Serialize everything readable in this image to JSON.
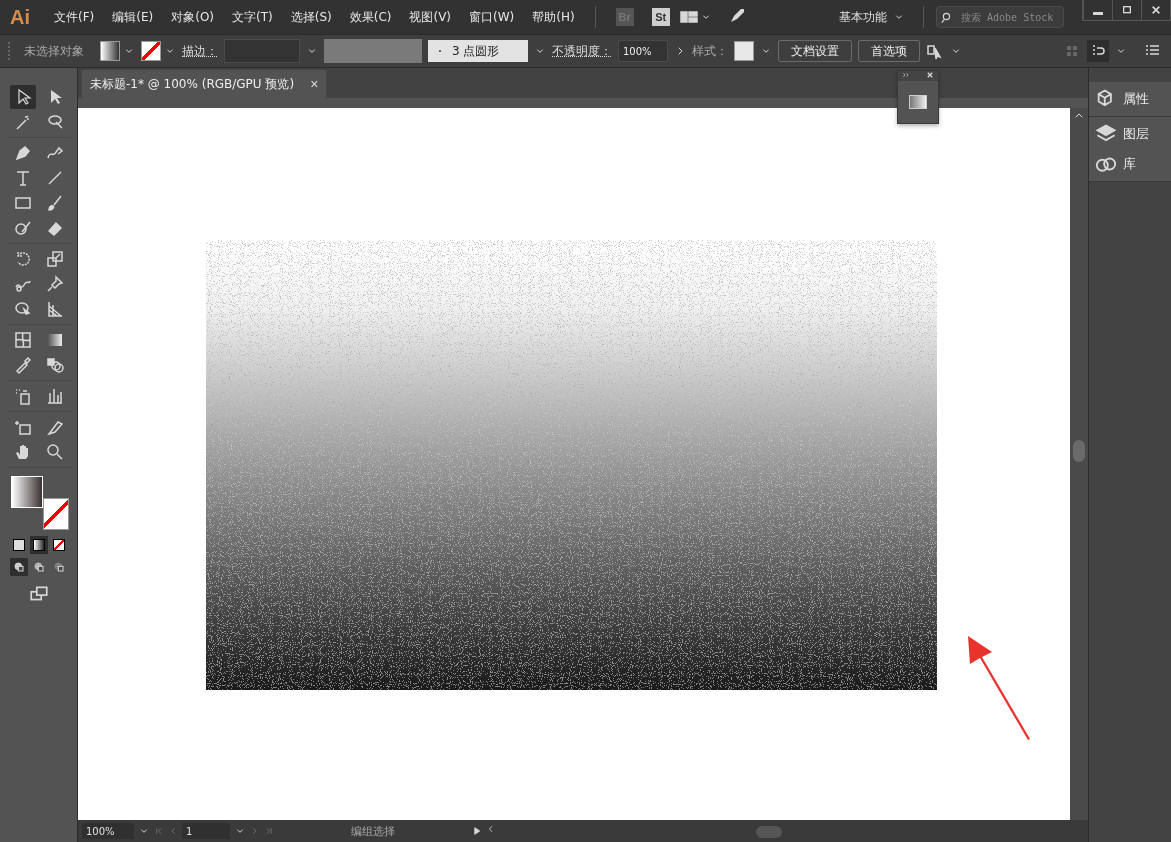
{
  "app_logo": "Ai",
  "menu": [
    "文件(F)",
    "编辑(E)",
    "对象(O)",
    "文字(T)",
    "选择(S)",
    "效果(C)",
    "视图(V)",
    "窗口(W)",
    "帮助(H)"
  ],
  "app_badges": [
    {
      "label": "Br",
      "disabled": true
    },
    {
      "label": "St",
      "disabled": false
    }
  ],
  "workspace": "基本功能",
  "search": {
    "placeholder": "搜索 Adobe Stock"
  },
  "control_bar": {
    "selection": "未选择对象",
    "stroke_label": "描边：",
    "brush": "3 点圆形",
    "opacity_label": "不透明度：",
    "opacity": "100%",
    "style_label": "样式：",
    "buttons": [
      "文档设置",
      "首选项"
    ]
  },
  "document_tab": {
    "title": "未标题-1* @ 100% (RGB/GPU 预览)",
    "close": "×"
  },
  "tool_groups": [
    [
      {
        "kind": "selection",
        "selected": true
      },
      {
        "kind": "direct",
        "selected": false
      },
      {
        "kind": "wand",
        "selected": false
      },
      {
        "kind": "lasso",
        "selected": false
      }
    ],
    [
      {
        "kind": "pen",
        "selected": false
      },
      {
        "kind": "curvature",
        "selected": false
      },
      {
        "kind": "type",
        "selected": false
      },
      {
        "kind": "line",
        "selected": false
      },
      {
        "kind": "rect",
        "selected": false
      },
      {
        "kind": "brush",
        "selected": false
      },
      {
        "kind": "shaper",
        "selected": false
      },
      {
        "kind": "eraser",
        "selected": false
      }
    ],
    [
      {
        "kind": "rotate",
        "selected": false
      },
      {
        "kind": "scale",
        "selected": false
      },
      {
        "kind": "warp",
        "selected": false
      },
      {
        "kind": "pin",
        "selected": false
      },
      {
        "kind": "shapebuilder",
        "selected": false
      },
      {
        "kind": "perspective",
        "selected": false
      }
    ],
    [
      {
        "kind": "mesh",
        "selected": false
      },
      {
        "kind": "gradient",
        "selected": false
      },
      {
        "kind": "eyedropper",
        "selected": false
      },
      {
        "kind": "blend",
        "selected": false
      }
    ],
    [
      {
        "kind": "spray",
        "selected": false
      },
      {
        "kind": "chart",
        "selected": false
      }
    ],
    [
      {
        "kind": "artboard",
        "selected": false
      },
      {
        "kind": "knife",
        "selected": false
      },
      {
        "kind": "hand",
        "selected": false
      },
      {
        "kind": "zoom",
        "selected": false
      }
    ]
  ],
  "fill_modes": [
    {
      "kind": "color",
      "selected": false
    },
    {
      "kind": "gradient",
      "selected": true
    },
    {
      "kind": "none",
      "selected": false
    }
  ],
  "draw_modes": [
    {
      "kind": "normal",
      "selected": true
    },
    {
      "kind": "behind",
      "selected": false
    },
    {
      "kind": "inside",
      "selected": false
    }
  ],
  "right_panel": [
    {
      "kind": "properties",
      "label": "属性"
    },
    {
      "kind": "layers",
      "label": "图层"
    },
    {
      "kind": "libraries",
      "label": "库"
    }
  ],
  "status_bar": {
    "zoom": "100%",
    "artboard": "1",
    "tool": "编组选择"
  }
}
